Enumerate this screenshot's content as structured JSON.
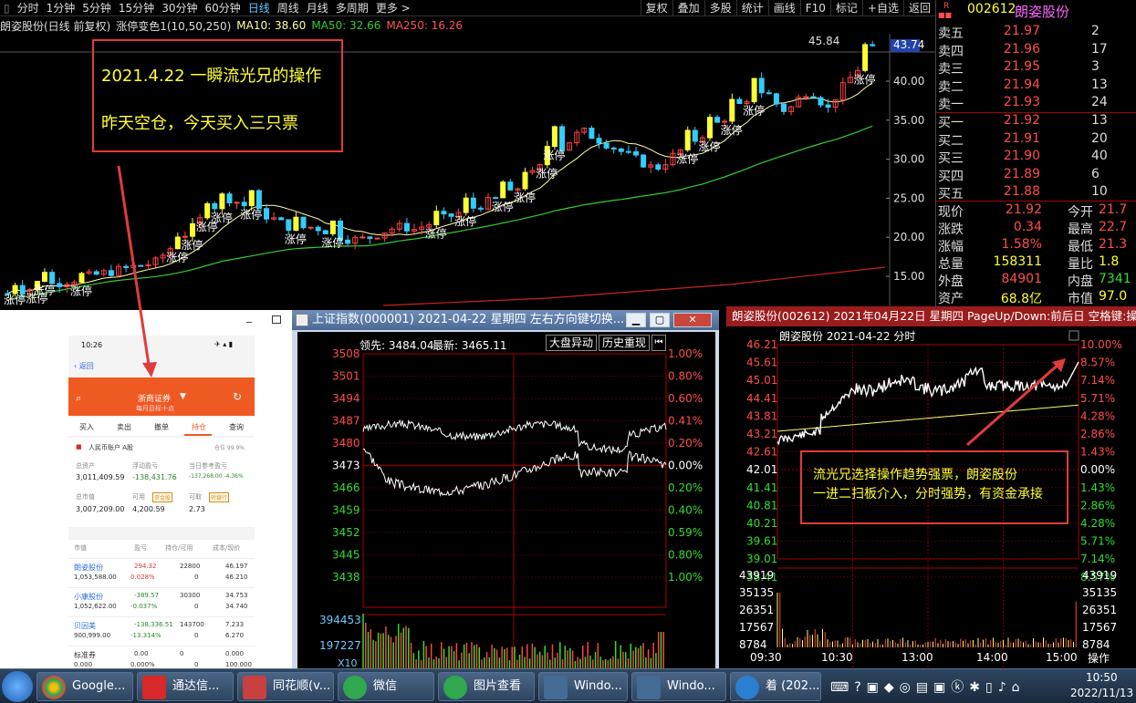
{
  "topbar": {
    "periods": [
      "分时",
      "1分钟",
      "5分钟",
      "15分钟",
      "30分钟",
      "60分钟",
      "日线",
      "周线",
      "月线",
      "多周期",
      "更多 >"
    ],
    "tools": [
      "复权",
      "叠加",
      "多股",
      "统计",
      "画线",
      "F10",
      "标记",
      "+自选",
      "返回"
    ],
    "info": {
      "stock": "朗姿股份(日线 前复权)",
      "indicator": "涨停变色1(10,50,250)",
      "ma10": "MA10: 38.60",
      "ma50": "MA50: 32.66",
      "ma250": "MA250: 16.26"
    }
  },
  "chart": {
    "y_ticks": [
      "45.84",
      "43.74",
      "40.00",
      "35.00",
      "30.00",
      "25.00",
      "20.00",
      "15.00"
    ],
    "limit_label": "涨停",
    "colors": {
      "up": "#ffff33",
      "down": "#33ccff",
      "ma10": "#ffffaa",
      "ma50": "#33cc33",
      "ma250": "#cc2222"
    }
  },
  "annotation1": {
    "line1": "2021.4.22   一瞬流光兄的操作",
    "line2": "昨天空仓，今天买入三只票"
  },
  "annotation2": {
    "line1": "流光兄选择操作趋势强票，朗姿股份",
    "line2": "一进二扫板介入，分时强势，有资金承接"
  },
  "quote": {
    "code": "002612",
    "name": "朗姿股份",
    "flag": "R",
    "asks": [
      {
        "label": "卖五",
        "price": "21.97",
        "vol": "2"
      },
      {
        "label": "卖四",
        "price": "21.96",
        "vol": "17"
      },
      {
        "label": "卖三",
        "price": "21.95",
        "vol": "3"
      },
      {
        "label": "卖二",
        "price": "21.94",
        "vol": "13"
      },
      {
        "label": "卖一",
        "price": "21.93",
        "vol": "24"
      }
    ],
    "bids": [
      {
        "label": "买一",
        "price": "21.92",
        "vol": "13"
      },
      {
        "label": "买二",
        "price": "21.91",
        "vol": "20"
      },
      {
        "label": "买三",
        "price": "21.90",
        "vol": "40"
      },
      {
        "label": "买四",
        "price": "21.89",
        "vol": "6"
      },
      {
        "label": "买五",
        "price": "21.88",
        "vol": "10"
      }
    ],
    "stats": [
      {
        "l1": "现价",
        "v1": "21.92",
        "l2": "今开",
        "v2": "21.7"
      },
      {
        "l1": "涨跌",
        "v1": "0.34",
        "l2": "最高",
        "v2": "22.7"
      },
      {
        "l1": "涨幅",
        "v1": "1.58%",
        "l2": "最低",
        "v2": "21.3"
      },
      {
        "l1": "总量",
        "v1": "158311",
        "l2": "量比",
        "v2": "1.8"
      },
      {
        "l1": "外盘",
        "v1": "84901",
        "l2": "内盘",
        "v2": "7341"
      },
      {
        "l1": "资产",
        "v1": "68.8亿",
        "l2": "市值",
        "v2": "97.0"
      }
    ]
  },
  "index_window": {
    "title": "上证指数(000001) 2021-04-22 星期四    左右方向键切换...",
    "lead": "领先: 3484.04",
    "latest": "最新: 3465.11",
    "btn1": "大盘异动",
    "btn2": "历史重现",
    "y_left": [
      "3508",
      "3501",
      "3494",
      "3487",
      "3480",
      "3473",
      "3466",
      "3459",
      "3452",
      "3445",
      "3438"
    ],
    "y_right": [
      "1.00%",
      "0.80%",
      "0.60%",
      "0.41%",
      "0.20%",
      "0.00%",
      "0.20%",
      "0.40%",
      "0.59%",
      "0.80%",
      "1.00%"
    ],
    "vol_left": [
      "394453",
      "197227"
    ],
    "vol_unit": "X10"
  },
  "intraday_window": {
    "title": "朗姿股份(002612) 2021年04月22日 星期四 PageUp/Down:前后日 空格键:操作",
    "subtitle": "朗姿股份   2021-04-22 分时",
    "y_left": [
      "46.21",
      "45.61",
      "45.01",
      "44.41",
      "43.81",
      "43.21",
      "42.61",
      "42.01",
      "41.41",
      "40.81",
      "40.21",
      "39.61",
      "39.01",
      "38.41"
    ],
    "y_right": [
      "10.00%",
      "8.57%",
      "7.14%",
      "5.71%",
      "4.28%",
      "2.86%",
      "1.43%",
      "0.00%",
      "1.43%",
      "2.86%",
      "4.28%",
      "5.71%",
      "7.14%",
      "8.57%"
    ],
    "vol_left": [
      "43919",
      "35135",
      "26351",
      "17567",
      "8784"
    ],
    "x_ticks": [
      "09:30",
      "10:30",
      "13:00",
      "14:00",
      "15:00"
    ],
    "op": "操作"
  },
  "phone": {
    "time": "10:26",
    "back": "返回",
    "broker": "浙商证券",
    "slogan": "每月目标十点",
    "tabs": [
      "买入",
      "卖出",
      "撤单",
      "持仓",
      "查询"
    ],
    "account": "人民币账户 A股",
    "position_pct": "仓位 99.9%",
    "total_asset_label": "总资产",
    "total_asset": "3,011,409.59",
    "float_pl_label": "浮动盈亏",
    "float_pl": "-138,431.76",
    "day_pl_label": "当日参考盈亏",
    "day_pl": "-137,268.00  -4.36%",
    "mv_label": "总市值",
    "mv": "3,007,209.00",
    "avail_label": "可用",
    "avail": "4,200.59",
    "avail_tag": "资金股",
    "draw_label": "可取",
    "draw": "2.73",
    "draw_tag": "转银行",
    "cols": [
      "市值",
      "盈亏",
      "持仓/可用",
      "成本/现价"
    ],
    "rows": [
      {
        "name": "朗姿股份",
        "mv": "1,053,588.00",
        "pl": "294.32",
        "plp": "0.028%",
        "hold": "22800",
        "avail": "0",
        "cost": "46.197",
        "price": "46.210"
      },
      {
        "name": "小康股份",
        "mv": "1,052,622.00",
        "pl": "-389.57",
        "plp": "-0.037%",
        "hold": "30300",
        "avail": "0",
        "cost": "34.753",
        "price": "34.740"
      },
      {
        "name": "贝因美",
        "mv": "900,999.00",
        "pl": "-138,336.51",
        "plp": "-13.314%",
        "hold": "143700",
        "avail": "0",
        "cost": "7.233",
        "price": "6.270"
      },
      {
        "name": "标准券",
        "mv": "0.000",
        "pl": "0.00",
        "plp": "0.000%",
        "hold": "0",
        "avail": "0",
        "cost": "0.000",
        "price": "100.000"
      }
    ]
  },
  "taskbar": {
    "items": [
      "Google...",
      "通达信...",
      "同花顺(v...",
      "微信",
      "图片查看",
      "Windo...",
      "Windo...",
      "着 (202..."
    ],
    "time": "10:50",
    "date": "2022/11/13"
  }
}
